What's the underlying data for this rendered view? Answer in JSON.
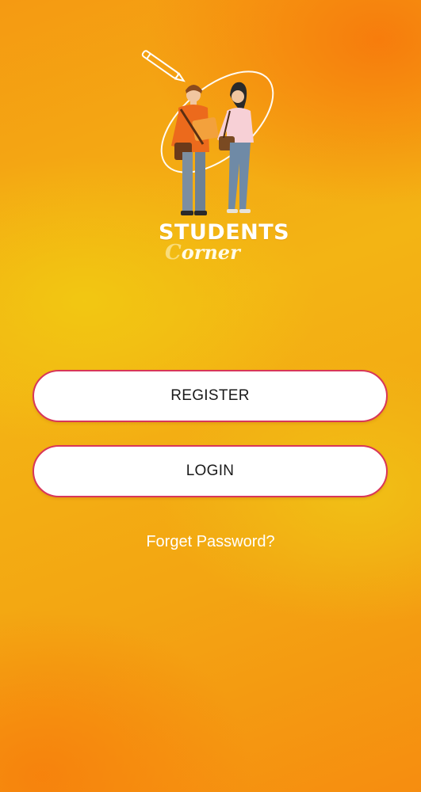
{
  "logo": {
    "brand_line1": "STUDENTS",
    "brand_line2_initial": "C",
    "brand_line2_rest": "orner",
    "illustration": "students-illustration"
  },
  "actions": {
    "register_label": "REGISTER",
    "login_label": "LOGIN",
    "forgot_label": "Forget Password?"
  },
  "colors": {
    "background_orange": "#f68d10",
    "background_yellow": "#f2c812",
    "button_fill": "#ffffff",
    "button_border": "#d8365a",
    "button_text": "#1a1a1a",
    "link_text": "#ffffff"
  }
}
